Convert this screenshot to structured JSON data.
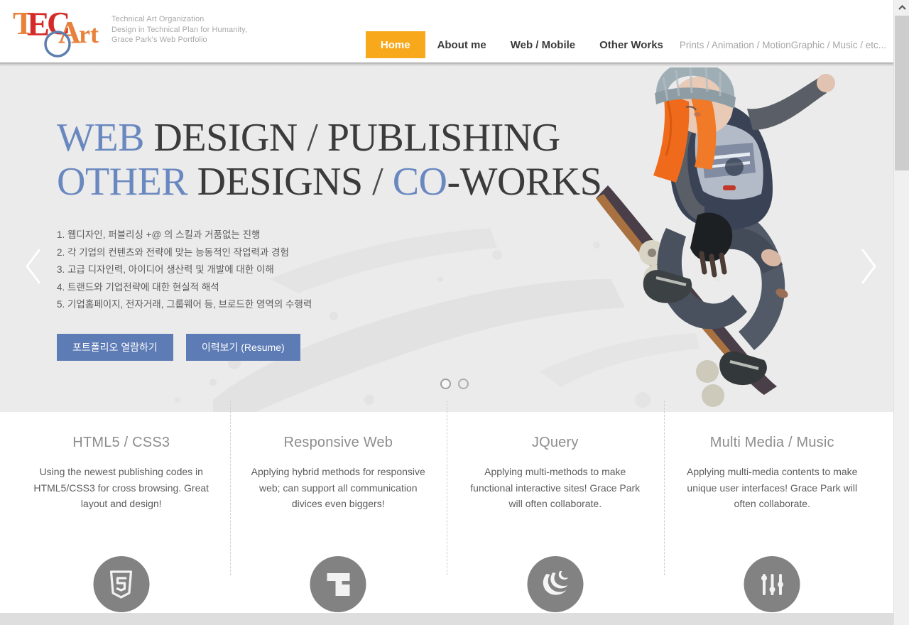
{
  "brand": {
    "logo_text": "TECArt",
    "logo_letters": [
      "T",
      "E",
      "C",
      "A",
      "r",
      "t",
      "O"
    ],
    "colors": {
      "orange": "#E8813A",
      "red": "#D52B28",
      "blue": "#5F7FAE"
    },
    "tagline_line1": "Technical Art Organization",
    "tagline_line2": "Design in Technical Plan for Humanity,",
    "tagline_line3": "Grace Park's Web Portfolio"
  },
  "nav": {
    "accent_color": "#F7A81B",
    "items": [
      {
        "label": "Home",
        "active": true
      },
      {
        "label": "About me",
        "active": false
      },
      {
        "label": "Web / Mobile",
        "active": false
      },
      {
        "label": "Other Works",
        "active": false
      }
    ],
    "sub_label": "Prints / Animation / MotionGraphic / Music / etc..."
  },
  "hero": {
    "title_line1": [
      {
        "text": "WEB",
        "accent": true
      },
      {
        "text": " DESIGN ",
        "accent": false
      },
      {
        "text": "/",
        "accent": false
      },
      {
        "text": " PUBLISHING",
        "accent": false
      }
    ],
    "title_line2": [
      {
        "text": "OTHER",
        "accent": true
      },
      {
        "text": " DESIGNS ",
        "accent": false
      },
      {
        "text": "/",
        "accent": false
      },
      {
        "text": " CO",
        "accent": true
      },
      {
        "text": "-WORKS",
        "accent": false
      }
    ],
    "title_plain_line1": "WEB DESIGN / PUBLISHING",
    "title_plain_line2": "OTHER DESIGNS / CO-WORKS",
    "accent_color": "#6A88C0",
    "bullets": [
      "1. 웹디자인, 퍼블리싱 +@ 의 스킬과 거품없는 진행",
      "2. 각 기업의 컨텐츠와 전략에 맞는 능동적인 작업력과 경험",
      "3. 고급 디자인력, 아이디어 생산력 및 개발에 대한 이해",
      "4. 트랜드와 기업전략에 대한 현실적 해석",
      "5. 기업홈페이지, 전자거래, 그룹웨어 등, 브로드한 영역의 수행력"
    ],
    "buttons": [
      {
        "label": "포트폴리오 열람하기"
      },
      {
        "label": "이력보기 (Resume)"
      }
    ],
    "button_color": "#5D7BB5",
    "background_color": "#EBEBEB",
    "prev_arrow_icon": "chevron-left-icon",
    "next_arrow_icon": "chevron-right-icon",
    "slide_count": 2,
    "active_slide": 1,
    "image_alt": "skateboarder"
  },
  "features": [
    {
      "title": "HTML5 / CSS3",
      "body": "Using the newest publishing codes in HTML5/CSS3 for cross browsing. Great layout and design!",
      "icon": "html5-shield-icon"
    },
    {
      "title": "Responsive Web",
      "body": "Applying hybrid methods for responsive web; can support all communication divices even biggers!",
      "icon": "responsive-grid-icon"
    },
    {
      "title": "JQuery",
      "body": "Applying multi-methods to make functional interactive sites! Grace Park will often collaborate.",
      "icon": "jquery-logo-icon"
    },
    {
      "title": "Multi Media / Music",
      "body": "Applying multi-media contents to make unique user interfaces! Grace Park will often collaborate.",
      "icon": "equalizer-sliders-icon"
    }
  ],
  "feature_icon_color": "#828282",
  "scrollbar": {
    "up_icon": "chevron-up-icon"
  }
}
